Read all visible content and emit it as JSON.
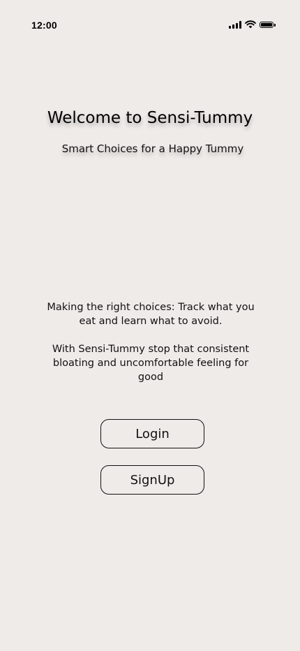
{
  "status_bar": {
    "time": "12:00",
    "icons": [
      "cellular-signal-icon",
      "wifi-icon",
      "battery-icon"
    ]
  },
  "welcome": {
    "title": "Welcome to Sensi-Tummy",
    "subtitle": "Smart Choices for a Happy Tummy"
  },
  "description": {
    "paragraph_1": "Making the right choices: Track what you eat and learn what to avoid.",
    "paragraph_2": "With Sensi-Tummy stop that consistent bloating and uncomfortable feeling for good"
  },
  "actions": {
    "login_label": "Login",
    "signup_label": "SignUp"
  },
  "colors": {
    "background": "#efebe9",
    "text": "#111111",
    "button_border": "#111111"
  }
}
